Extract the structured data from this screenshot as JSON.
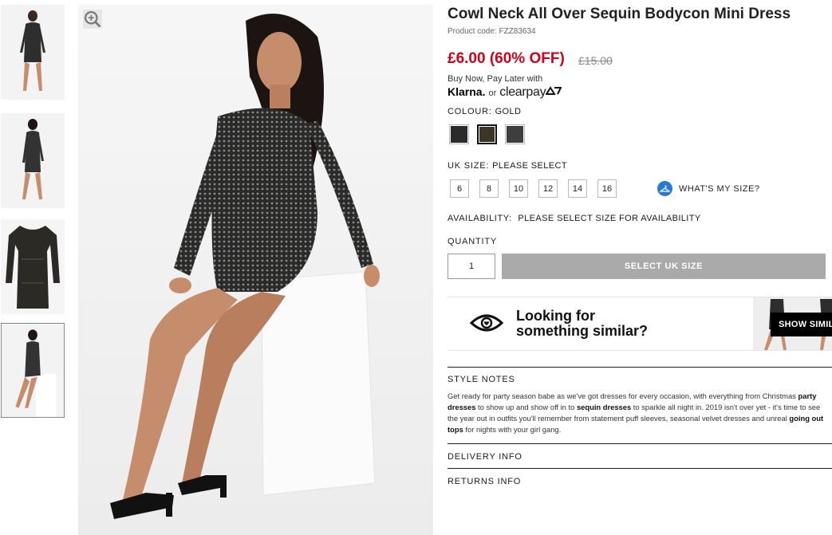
{
  "product": {
    "title": "Cowl Neck All Over Sequin Bodycon Mini Dress",
    "code": "Product code: FZZ83634",
    "price": "£6.00 (60% OFF)",
    "old_price": "£15.00"
  },
  "bnpl": {
    "text": "Buy Now, Pay Later with",
    "klarna": "Klarna.",
    "or": "or",
    "clearpay": "clearpay"
  },
  "colour": {
    "label": "COLOUR:",
    "value": "GOLD",
    "swatches": [
      {
        "name": "black",
        "color": "#2b2b2b"
      },
      {
        "name": "gold",
        "color": "#3a3525"
      },
      {
        "name": "silver",
        "color": "#3d3f3f"
      }
    ]
  },
  "size": {
    "label": "UK SIZE:",
    "value": "PLEASE SELECT",
    "options": [
      "6",
      "8",
      "10",
      "12",
      "14",
      "16"
    ],
    "whats_my_size": "WHAT'S MY SIZE?"
  },
  "availability": {
    "label": "AVAILABILITY:",
    "value": "PLEASE SELECT SIZE FOR AVAILABILITY"
  },
  "quantity": {
    "label": "QUANTITY",
    "value": "1",
    "button": "SELECT UK SIZE"
  },
  "similar": {
    "line1": "Looking for",
    "line2": "something similar?",
    "button": "SHOW SIMILAR"
  },
  "style_notes": {
    "heading": "STYLE NOTES",
    "t1": "Get ready for party season babe as we've got dresses for every occasion, with everything from Christmas ",
    "b1": "party",
    "b2": "dresses",
    "t2": " to show up and show off in to ",
    "b3": "sequin dresses",
    "t3": " to sparkle all night in. 2019 isn't over yet - it's time to see the year out in outfits you'll remember from statement puff sleeves, seasonal velvet dresses and unreal ",
    "b4": "going out tops",
    "t4": " for nights with your girl gang."
  },
  "delivery": {
    "heading": "DELIVERY INFO"
  },
  "returns": {
    "heading": "RETURNS INFO"
  },
  "colors": {
    "price_red": "#d0021b",
    "button_grey": "#aaaaaa",
    "hanger_blue": "#2979d6"
  }
}
